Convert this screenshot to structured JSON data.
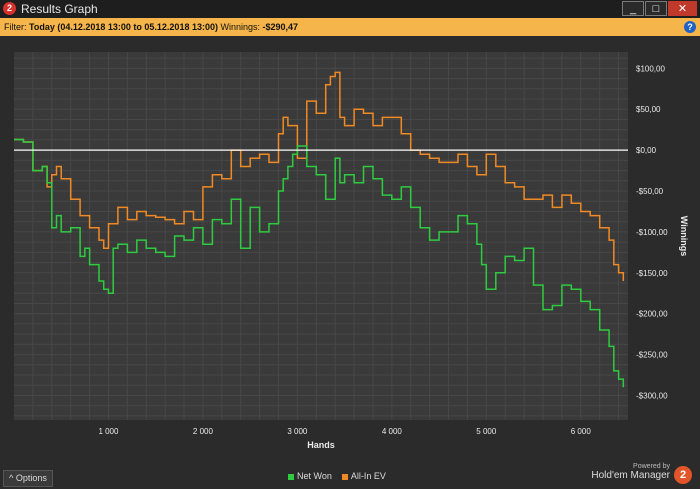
{
  "window": {
    "title": "Results Graph",
    "app_icon": "2",
    "minimize": "_",
    "maximize": "□",
    "close": "✕"
  },
  "filter": {
    "prefix": "Filter: ",
    "range": "Today (04.12.2018 13:00 to 05.12.2018 13:00)",
    "winnings_label": "Winnings: ",
    "winnings_value": "-$290,47",
    "help": "?"
  },
  "bottom": {
    "options_label": "Options",
    "powered_by": "Powered by",
    "brand": "Hold'em Manager",
    "brand_logo": "2"
  },
  "colors": {
    "net_won": "#2ecc40",
    "all_in_ev": "#f08a24",
    "zero_line": "#ffffff",
    "filter_bar": "#f5b54a"
  },
  "chart_data": {
    "type": "line",
    "xlabel": "Hands",
    "ylabel": "Winnings",
    "xlim": [
      0,
      6500
    ],
    "ylim": [
      -330,
      120
    ],
    "x_ticks": [
      1000,
      2000,
      3000,
      4000,
      5000,
      6000
    ],
    "x_tick_labels": [
      "1 000",
      "2 000",
      "3 000",
      "4 000",
      "5 000",
      "6 000"
    ],
    "y_ticks": [
      100,
      50,
      0,
      -50,
      -100,
      -150,
      -200,
      -250,
      -300
    ],
    "y_tick_labels": [
      "$100,00",
      "$50,00",
      "$0,00",
      "-$50,00",
      "-$100,00",
      "-$150,00",
      "-$200,00",
      "-$250,00",
      "-$300,00"
    ],
    "grid": true,
    "zero_line": 0,
    "legend_position": "bottom-center",
    "series": [
      {
        "name": "Net Won",
        "color": "#2ecc40",
        "x": [
          0,
          100,
          200,
          300,
          350,
          400,
          450,
          500,
          600,
          700,
          750,
          800,
          900,
          950,
          1000,
          1050,
          1100,
          1200,
          1300,
          1400,
          1500,
          1600,
          1700,
          1800,
          1900,
          2000,
          2100,
          2200,
          2300,
          2400,
          2500,
          2600,
          2700,
          2800,
          2850,
          2900,
          2950,
          3000,
          3100,
          3200,
          3300,
          3400,
          3450,
          3500,
          3600,
          3700,
          3800,
          3900,
          4000,
          4100,
          4200,
          4300,
          4400,
          4500,
          4600,
          4700,
          4800,
          4900,
          4950,
          5000,
          5100,
          5200,
          5300,
          5400,
          5500,
          5600,
          5700,
          5800,
          5900,
          6000,
          6100,
          6200,
          6300,
          6350,
          6400,
          6450
        ],
        "y": [
          13,
          10,
          -25,
          -20,
          -40,
          -95,
          -80,
          -100,
          -95,
          -130,
          -120,
          -140,
          -160,
          -170,
          -175,
          -120,
          -115,
          -125,
          -110,
          -120,
          -125,
          -130,
          -105,
          -110,
          -95,
          -115,
          -85,
          -90,
          -60,
          -120,
          -70,
          -100,
          -90,
          -50,
          -35,
          -20,
          -5,
          5,
          -20,
          -30,
          -60,
          -10,
          -40,
          -30,
          -40,
          -20,
          -35,
          -55,
          -60,
          -45,
          -70,
          -95,
          -110,
          -100,
          -100,
          -80,
          -90,
          -115,
          -140,
          -170,
          -150,
          -130,
          -135,
          -120,
          -165,
          -195,
          -190,
          -165,
          -170,
          -185,
          -195,
          -220,
          -240,
          -270,
          -280,
          -290
        ]
      },
      {
        "name": "All-In EV",
        "color": "#f08a24",
        "x": [
          0,
          100,
          200,
          300,
          350,
          400,
          450,
          500,
          600,
          700,
          800,
          900,
          950,
          1000,
          1100,
          1200,
          1300,
          1400,
          1500,
          1600,
          1700,
          1800,
          1900,
          2000,
          2100,
          2200,
          2300,
          2400,
          2500,
          2600,
          2700,
          2800,
          2850,
          2900,
          3000,
          3100,
          3200,
          3300,
          3350,
          3400,
          3450,
          3500,
          3600,
          3700,
          3800,
          3900,
          4000,
          4100,
          4200,
          4300,
          4400,
          4500,
          4600,
          4700,
          4800,
          4900,
          5000,
          5100,
          5200,
          5300,
          5400,
          5500,
          5600,
          5700,
          5800,
          5900,
          6000,
          6100,
          6200,
          6300,
          6350,
          6400,
          6450
        ],
        "y": [
          13,
          10,
          -25,
          -20,
          -45,
          -30,
          -20,
          -35,
          -60,
          -80,
          -95,
          -110,
          -120,
          -90,
          -70,
          -85,
          -75,
          -80,
          -82,
          -85,
          -90,
          -75,
          -85,
          -45,
          -30,
          -35,
          0,
          -20,
          -10,
          -5,
          -15,
          20,
          40,
          30,
          -10,
          60,
          45,
          80,
          90,
          95,
          40,
          30,
          50,
          45,
          30,
          40,
          40,
          20,
          0,
          -5,
          -10,
          -15,
          -15,
          -5,
          -20,
          -30,
          -5,
          -20,
          -40,
          -45,
          -60,
          -60,
          -55,
          -70,
          -55,
          -65,
          -75,
          -80,
          -95,
          -110,
          -140,
          -150,
          -160
        ]
      }
    ]
  }
}
